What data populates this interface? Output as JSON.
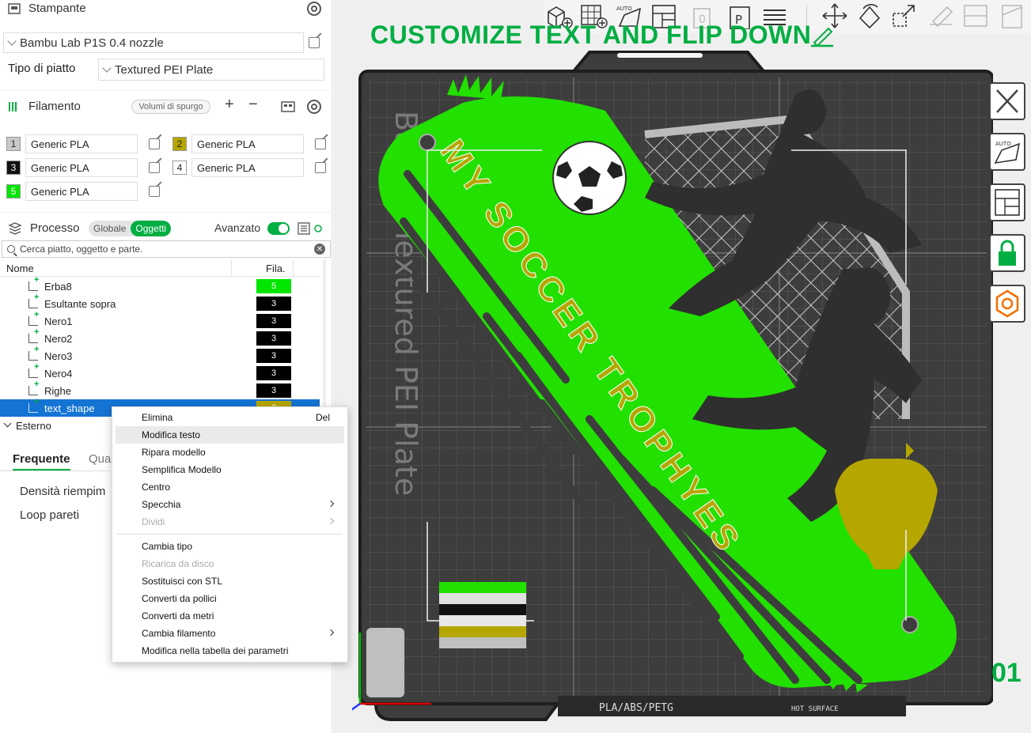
{
  "printer": {
    "section_title": "Stampante",
    "model": "Bambu Lab P1S 0.4 nozzle",
    "plate_label": "Tipo di piatto",
    "plate_value": "Textured PEI Plate"
  },
  "filament": {
    "section_title": "Filamento",
    "purge_button": "Volumi di spurgo",
    "items": [
      {
        "num": "1",
        "name": "Generic PLA",
        "color": "#c8c8c8",
        "text_color": "#222"
      },
      {
        "num": "2",
        "name": "Generic PLA",
        "color": "#b5a600",
        "text_color": "#222"
      },
      {
        "num": "3",
        "name": "Generic PLA",
        "color": "#111111",
        "text_color": "#fff"
      },
      {
        "num": "4",
        "name": "Generic PLA",
        "color": "#ffffff",
        "text_color": "#222"
      },
      {
        "num": "5",
        "name": "Generic PLA",
        "color": "#00e600",
        "text_color": "#fff"
      }
    ]
  },
  "process": {
    "section_title": "Processo",
    "toggle_global": "Globale",
    "toggle_objects": "Oggetti",
    "advanced_label": "Avanzato",
    "search_placeholder": "Cerca piatto, oggetto e parte."
  },
  "tree": {
    "col_name": "Nome",
    "col_fila": "Fila.",
    "rows": [
      {
        "name": "Erba8",
        "fila": "5",
        "fila_color": "#00e600"
      },
      {
        "name": "Esultante sopra",
        "fila": "3",
        "fila_color": "#000000"
      },
      {
        "name": "Nero1",
        "fila": "3",
        "fila_color": "#000000"
      },
      {
        "name": "Nero2",
        "fila": "3",
        "fila_color": "#000000"
      },
      {
        "name": "Nero3",
        "fila": "3",
        "fila_color": "#000000"
      },
      {
        "name": "Nero4",
        "fila": "3",
        "fila_color": "#000000"
      },
      {
        "name": "Righe",
        "fila": "3",
        "fila_color": "#000000"
      },
      {
        "name": "text_shape",
        "fila": "2",
        "fila_color": "#b5a600"
      }
    ],
    "group": "Esterno"
  },
  "settings_tabs": {
    "active": "Frequente",
    "other": "Qua"
  },
  "settings_rows": [
    "Densità riempim",
    "Loop pareti"
  ],
  "context_menu": {
    "items": [
      {
        "label": "Elimina",
        "shortcut": "Del"
      },
      {
        "label": "Modifica testo",
        "highlight": true
      },
      {
        "label": "Ripara modello"
      },
      {
        "label": "Semplifica Modello"
      },
      {
        "label": "Centro"
      },
      {
        "label": "Specchia",
        "submenu": true
      },
      {
        "label": "Dividi",
        "submenu": true,
        "disabled": true
      },
      {
        "label": "Cambia tipo"
      },
      {
        "label": "Ricarica da disco",
        "disabled": true
      },
      {
        "label": "Sostituisci con STL"
      },
      {
        "label": "Converti da pollici"
      },
      {
        "label": "Converti da metri"
      },
      {
        "label": "Cambia filamento",
        "submenu": true
      },
      {
        "label": "Modifica nella tabella dei parametri"
      }
    ]
  },
  "view": {
    "headline": "CUSTOMIZE TEXT AND FLIP DOWN",
    "model_text": "MY SOCCER TROPHYES",
    "bed_text": "Bambu Textured PEI Plate",
    "bed_bottom_label": "PLA/ABS/PETG",
    "hot_surface": "HOT SURFACE",
    "plate_number": "01",
    "accent": "#00ae42",
    "model_green": "#22e000",
    "text_gold": "#b5a600"
  }
}
